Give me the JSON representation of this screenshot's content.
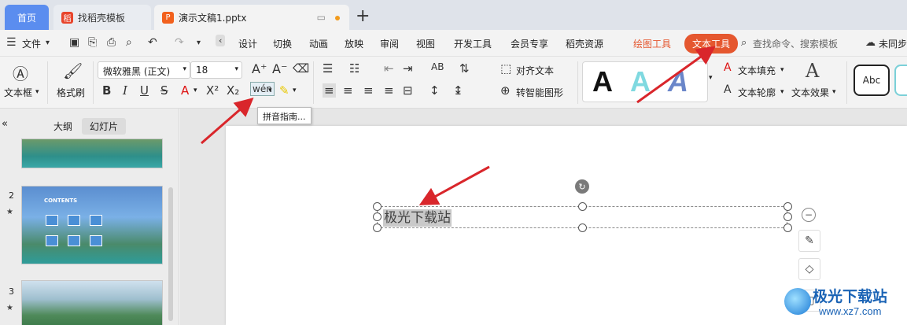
{
  "tabs": {
    "home": "首页",
    "find_template": "找稻壳模板",
    "document": "演示文稿1.pptx"
  },
  "menu": {
    "file": "文件",
    "items": [
      "设计",
      "切换",
      "动画",
      "放映",
      "审阅",
      "视图",
      "开发工具",
      "会员专享",
      "稻壳资源"
    ],
    "drawing_tools": "绘图工具",
    "text_tools": "文本工具",
    "search_placeholder": "查找命令、搜索模板",
    "sync": "未同步"
  },
  "ribbon": {
    "textbox": "文本框",
    "format_painter": "格式刷",
    "font_name": "微软雅黑 (正文)",
    "font_size": "18",
    "align_text": "对齐文本",
    "smart_shape": "转智能图形",
    "text_fill": "文本填充",
    "text_outline": "文本轮廓",
    "text_effect": "文本效果",
    "style_sample": "Abc",
    "pinyin_tooltip": "拼音指南..."
  },
  "panel": {
    "outline_tab": "大纲",
    "slides_tab": "幻灯片",
    "slide_numbers": [
      "2",
      "3"
    ],
    "thumb_title": "CONTENTS"
  },
  "canvas": {
    "selected_text": "极光下载站"
  },
  "watermark": {
    "name": "极光下载站",
    "url": "www.xz7.com"
  },
  "colors": {
    "accent": "#e5572f",
    "home_tab": "#5b8def",
    "arrow": "#d9262b",
    "watermark": "#1a63b5"
  }
}
